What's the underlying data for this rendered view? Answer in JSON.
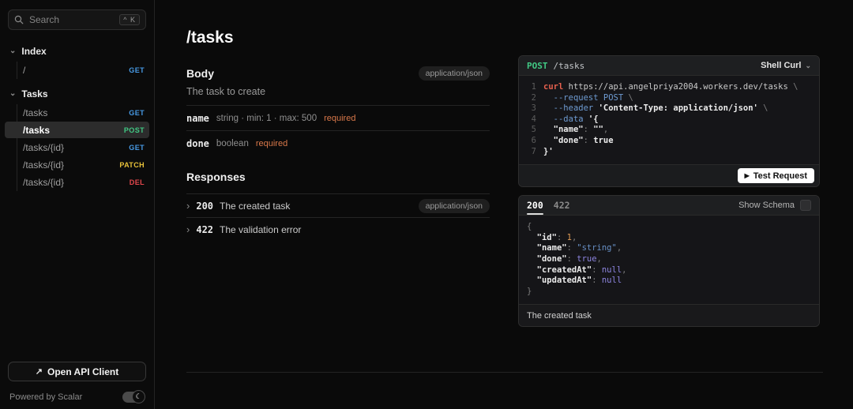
{
  "colors": {
    "get": "#479ae5",
    "post": "#41c984",
    "patch": "#e8c23a",
    "del": "#e5484d",
    "required": "#d9784a"
  },
  "sidebar": {
    "search": {
      "placeholder": "Search",
      "shortcut": "^ K"
    },
    "groups": [
      {
        "label": "Index",
        "items": [
          {
            "path": "/",
            "method": "GET",
            "active": false
          }
        ]
      },
      {
        "label": "Tasks",
        "items": [
          {
            "path": "/tasks",
            "method": "GET",
            "active": false
          },
          {
            "path": "/tasks",
            "method": "POST",
            "active": true
          },
          {
            "path": "/tasks/{id}",
            "method": "GET",
            "active": false
          },
          {
            "path": "/tasks/{id}",
            "method": "PATCH",
            "active": false
          },
          {
            "path": "/tasks/{id}",
            "method": "DEL",
            "active": false
          }
        ]
      }
    ],
    "open_api_client_label": "Open API Client",
    "open_api_client_icon": "↗",
    "powered_by": "Powered by Scalar"
  },
  "main": {
    "title": "/tasks",
    "body_section": {
      "heading": "Body",
      "content_type_badge": "application/json",
      "description": "The task to create",
      "fields": [
        {
          "name": "name",
          "type": "string · min: 1 · max: 500",
          "required": "required"
        },
        {
          "name": "done",
          "type": "boolean",
          "required": "required"
        }
      ]
    },
    "responses_section": {
      "heading": "Responses",
      "items": [
        {
          "code": "200",
          "description": "The created task",
          "content_type_badge": "application/json"
        },
        {
          "code": "422",
          "description": "The validation error",
          "content_type_badge": ""
        }
      ]
    }
  },
  "request_panel": {
    "method": "POST",
    "path": "/tasks",
    "client_label": "Shell Curl",
    "test_button_label": "Test Request",
    "test_button_icon": "▶",
    "code_lines": [
      [
        {
          "c": "cmd",
          "t": "curl"
        },
        {
          "c": "url",
          "t": " https://api.angelpriya2004.workers.dev/tasks "
        },
        {
          "c": "punc",
          "t": "\\"
        }
      ],
      [
        {
          "c": "url",
          "t": "  "
        },
        {
          "c": "flag",
          "t": "--request"
        },
        {
          "c": "flag",
          "t": " POST"
        },
        {
          "c": "punc",
          "t": " \\"
        }
      ],
      [
        {
          "c": "url",
          "t": "  "
        },
        {
          "c": "flag",
          "t": "--header"
        },
        {
          "c": "url",
          "t": " "
        },
        {
          "c": "str",
          "t": "'Content-Type: application/json'"
        },
        {
          "c": "punc",
          "t": " \\"
        }
      ],
      [
        {
          "c": "url",
          "t": "  "
        },
        {
          "c": "flag",
          "t": "--data"
        },
        {
          "c": "url",
          "t": " "
        },
        {
          "c": "str",
          "t": "'{"
        }
      ],
      [
        {
          "c": "url",
          "t": "  "
        },
        {
          "c": "key",
          "t": "\"name\""
        },
        {
          "c": "punc",
          "t": ": "
        },
        {
          "c": "str",
          "t": "\"\""
        },
        {
          "c": "punc",
          "t": ","
        }
      ],
      [
        {
          "c": "url",
          "t": "  "
        },
        {
          "c": "key",
          "t": "\"done\""
        },
        {
          "c": "punc",
          "t": ": "
        },
        {
          "c": "str",
          "t": "true"
        }
      ],
      [
        {
          "c": "str",
          "t": "}'"
        }
      ]
    ]
  },
  "response_panel": {
    "tabs": [
      {
        "label": "200",
        "active": true
      },
      {
        "label": "422",
        "active": false
      }
    ],
    "show_schema_label": "Show Schema",
    "footer": "The created task",
    "code_lines": [
      [
        {
          "c": "punc",
          "t": "{"
        }
      ],
      [
        {
          "c": "url",
          "t": "  "
        },
        {
          "c": "key",
          "t": "\"id\""
        },
        {
          "c": "punc",
          "t": ": "
        },
        {
          "c": "num",
          "t": "1"
        },
        {
          "c": "punc",
          "t": ","
        }
      ],
      [
        {
          "c": "url",
          "t": "  "
        },
        {
          "c": "key",
          "t": "\"name\""
        },
        {
          "c": "punc",
          "t": ": "
        },
        {
          "c": "vstr",
          "t": "\"string\""
        },
        {
          "c": "punc",
          "t": ","
        }
      ],
      [
        {
          "c": "url",
          "t": "  "
        },
        {
          "c": "key",
          "t": "\"done\""
        },
        {
          "c": "punc",
          "t": ": "
        },
        {
          "c": "kw",
          "t": "true"
        },
        {
          "c": "punc",
          "t": ","
        }
      ],
      [
        {
          "c": "url",
          "t": "  "
        },
        {
          "c": "key",
          "t": "\"createdAt\""
        },
        {
          "c": "punc",
          "t": ": "
        },
        {
          "c": "kw",
          "t": "null"
        },
        {
          "c": "punc",
          "t": ","
        }
      ],
      [
        {
          "c": "url",
          "t": "  "
        },
        {
          "c": "key",
          "t": "\"updatedAt\""
        },
        {
          "c": "punc",
          "t": ": "
        },
        {
          "c": "kw",
          "t": "null"
        }
      ],
      [
        {
          "c": "punc",
          "t": "}"
        }
      ]
    ]
  }
}
